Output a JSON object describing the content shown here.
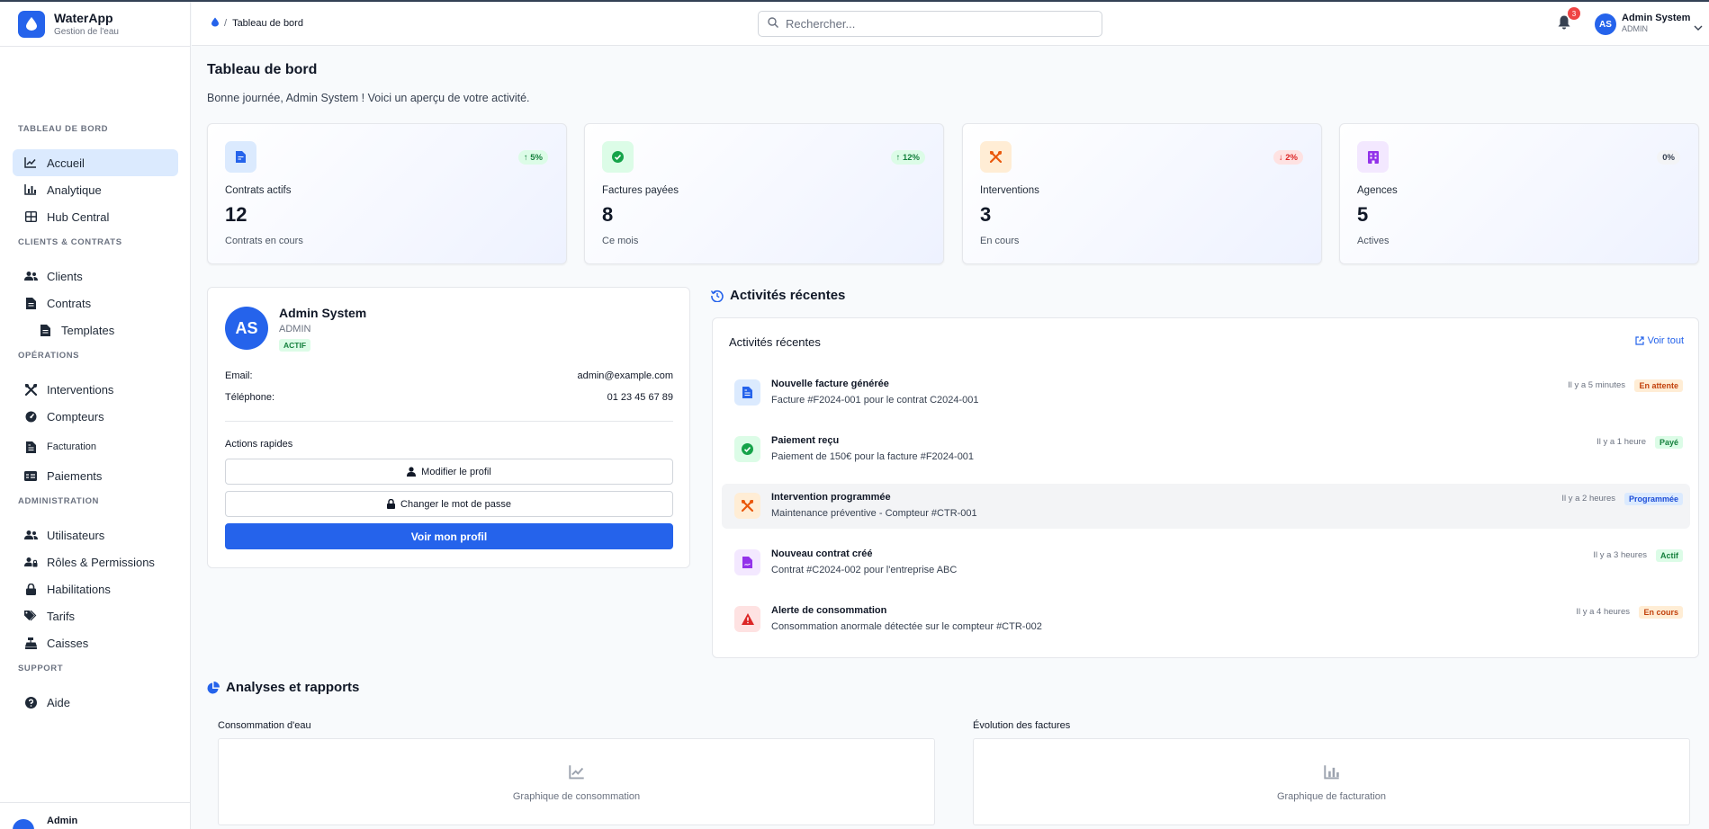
{
  "app": {
    "name": "WaterApp",
    "subtitle": "Gestion de l'eau"
  },
  "sidebar": {
    "sections": [
      {
        "title": "TABLEAU DE BORD",
        "items": [
          {
            "label": "Accueil",
            "icon": "chart-line-icon",
            "active": true
          },
          {
            "label": "Analytique",
            "icon": "chart-bar-icon"
          },
          {
            "label": "Hub Central",
            "icon": "grid-icon"
          }
        ]
      },
      {
        "title": "CLIENTS & CONTRATS",
        "items": [
          {
            "label": "Clients",
            "icon": "users-icon"
          },
          {
            "label": "Contrats",
            "icon": "file-icon"
          },
          {
            "label": "Templates",
            "icon": "file-icon"
          }
        ]
      },
      {
        "title": "OPÉRATIONS",
        "items": [
          {
            "label": "Interventions",
            "icon": "tools-icon"
          },
          {
            "label": "Compteurs",
            "icon": "gauge-icon"
          },
          {
            "label": "Facturation",
            "icon": "invoice-icon"
          },
          {
            "label": "Paiements",
            "icon": "card-icon"
          }
        ]
      },
      {
        "title": "ADMINISTRATION",
        "items": [
          {
            "label": "Utilisateurs",
            "icon": "users-icon"
          },
          {
            "label": "Rôles & Permissions",
            "icon": "user-lock-icon"
          },
          {
            "label": "Habilitations",
            "icon": "lock-icon"
          },
          {
            "label": "Tarifs",
            "icon": "tags-icon"
          },
          {
            "label": "Caisses",
            "icon": "cash-register-icon"
          }
        ]
      },
      {
        "title": "SUPPORT",
        "items": [
          {
            "label": "Aide",
            "icon": "help-icon"
          }
        ]
      }
    ],
    "footer_user": "Admin"
  },
  "header": {
    "breadcrumb": "Tableau de bord",
    "search_placeholder": "Rechercher...",
    "notification_count": "3",
    "user_initials": "AS",
    "user_name": "Admin System",
    "user_role": "ADMIN"
  },
  "page": {
    "title": "Tableau de bord",
    "subtitle": "Bonne journée, Admin System ! Voici un aperçu de votre activité."
  },
  "stats": [
    {
      "label": "Contrats actifs",
      "value": "12",
      "caption": "Contrats en cours",
      "change": "5%",
      "trend": "up",
      "color": "#2563eb",
      "bg": "#dbeafe"
    },
    {
      "label": "Factures payées",
      "value": "8",
      "caption": "Ce mois",
      "change": "12%",
      "trend": "up",
      "color": "#16a34a",
      "bg": "#dcfce7"
    },
    {
      "label": "Interventions",
      "value": "3",
      "caption": "En cours",
      "change": "2%",
      "trend": "down",
      "color": "#ea580c",
      "bg": "#ffedd5"
    },
    {
      "label": "Agences",
      "value": "5",
      "caption": "Actives",
      "change": "0%",
      "trend": "flat",
      "color": "#9333ea",
      "bg": "#f3e8ff"
    }
  ],
  "profile": {
    "initials": "AS",
    "name": "Admin System",
    "role": "ADMIN",
    "status": "ACTIF",
    "email_label": "Email:",
    "email": "admin@example.com",
    "phone_label": "Téléphone:",
    "phone": "01 23 45 67 89",
    "actions_title": "Actions rapides",
    "edit_profile": "Modifier le profil",
    "change_password": "Changer le mot de passe",
    "view_profile": "Voir mon profil"
  },
  "activity": {
    "section_title": "Activités récentes",
    "card_title": "Activités récentes",
    "see_all": "Voir tout",
    "items": [
      {
        "title": "Nouvelle facture générée",
        "desc": "Facture #F2024-001 pour le contrat C2024-001",
        "time": "Il y a 5 minutes",
        "badge": "En attente",
        "badge_color": "#c2410c",
        "badge_bg": "#ffedd5",
        "icon": "invoice-icon",
        "icon_color": "#2563eb",
        "icon_bg": "#dbeafe"
      },
      {
        "title": "Paiement reçu",
        "desc": "Paiement de 150€ pour la facture #F2024-001",
        "time": "Il y a 1 heure",
        "badge": "Payé",
        "badge_color": "#15803d",
        "badge_bg": "#dcfce7",
        "icon": "check-circle-icon",
        "icon_color": "#16a34a",
        "icon_bg": "#dcfce7"
      },
      {
        "title": "Intervention programmée",
        "desc": "Maintenance préventive - Compteur #CTR-001",
        "time": "Il y a 2 heures",
        "badge": "Programmée",
        "badge_color": "#1d4ed8",
        "badge_bg": "#dbeafe",
        "icon": "tools-icon",
        "icon_color": "#ea580c",
        "icon_bg": "#ffedd5"
      },
      {
        "title": "Nouveau contrat créé",
        "desc": "Contrat #C2024-002 pour l'entreprise ABC",
        "time": "Il y a 3 heures",
        "badge": "Actif",
        "badge_color": "#15803d",
        "badge_bg": "#dcfce7",
        "icon": "contract-icon",
        "icon_color": "#9333ea",
        "icon_bg": "#f3e8ff"
      },
      {
        "title": "Alerte de consommation",
        "desc": "Consommation anormale détectée sur le compteur #CTR-002",
        "time": "Il y a 4 heures",
        "badge": "En cours",
        "badge_color": "#c2410c",
        "badge_bg": "#ffedd5",
        "icon": "warning-icon",
        "icon_color": "#dc2626",
        "icon_bg": "#fee2e2"
      }
    ]
  },
  "reports": {
    "title": "Analyses et rapports",
    "charts": [
      {
        "label": "Consommation d'eau",
        "placeholder": "Graphique de consommation",
        "icon": "chart-line-icon"
      },
      {
        "label": "Évolution des factures",
        "placeholder": "Graphique de facturation",
        "icon": "chart-bar-icon"
      }
    ]
  }
}
